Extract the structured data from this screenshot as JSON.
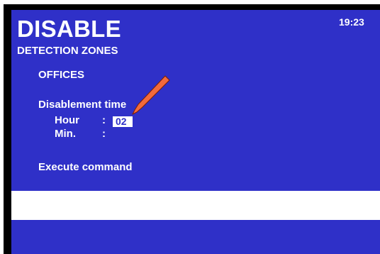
{
  "header": {
    "title": "DISABLE",
    "subtitle": "DETECTION ZONES",
    "clock": "19:23"
  },
  "main": {
    "zone_name": "OFFICES",
    "disablement_label": "Disablement time",
    "hour_label": "Hour",
    "hour_separator": ":",
    "hour_value": "02",
    "min_label": "Min.",
    "min_separator": ":",
    "min_value": "",
    "execute_label": "Execute command"
  },
  "message_bar": {
    "text": ""
  },
  "colors": {
    "screen_background": "#2f30c8",
    "frame": "#000000",
    "text": "#ffffff",
    "pointer_arrow": "#f26a3c"
  },
  "icons": {
    "pointer": "arrow-pointer-icon"
  }
}
